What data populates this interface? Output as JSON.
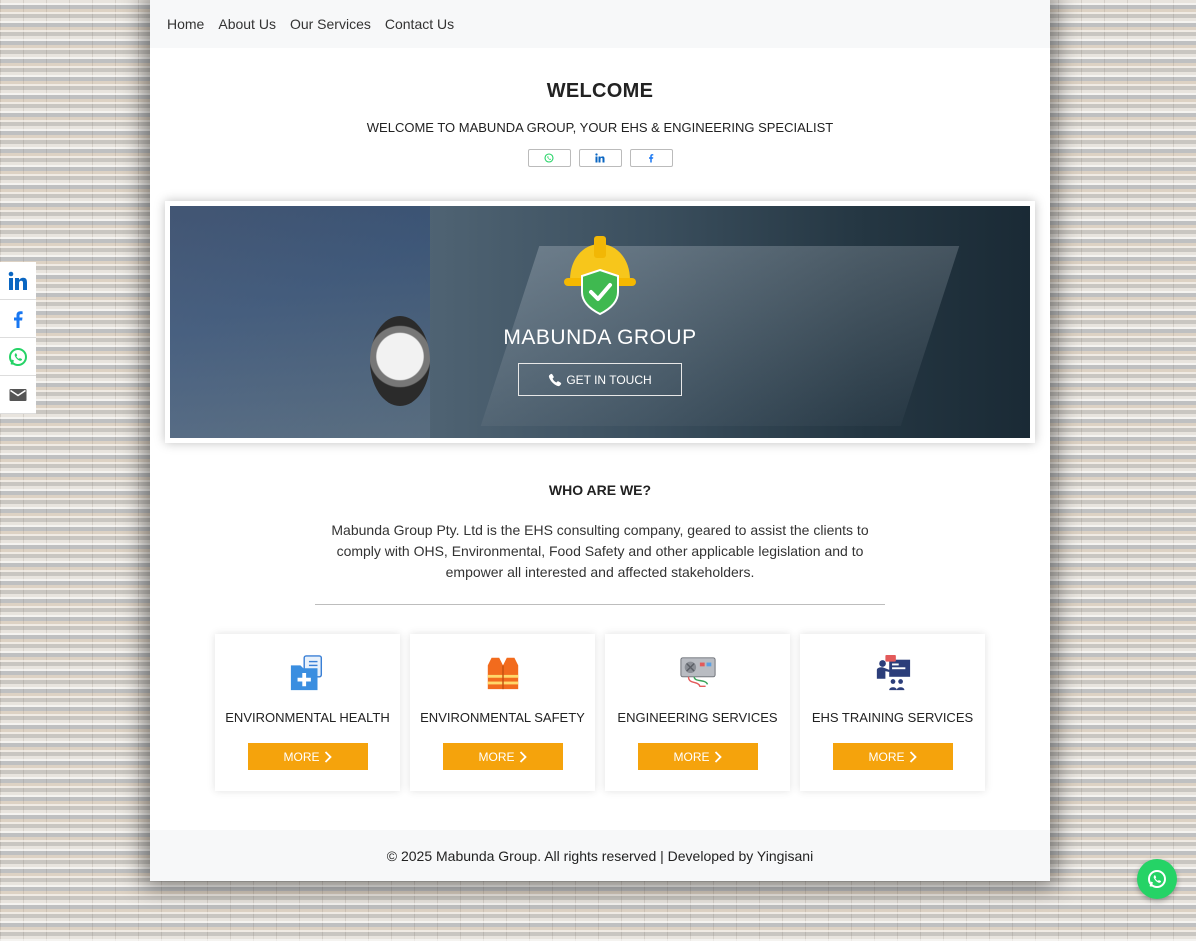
{
  "nav": {
    "items": [
      {
        "label": "Home"
      },
      {
        "label": "About Us"
      },
      {
        "label": "Our Services"
      },
      {
        "label": "Contact Us"
      }
    ]
  },
  "welcome": {
    "title": "WELCOME",
    "subtitle": "WELCOME TO MABUNDA GROUP, YOUR EHS & ENGINEERING SPECIALIST",
    "share_icons": [
      "whatsapp-icon",
      "linkedin-icon",
      "facebook-icon"
    ]
  },
  "hero": {
    "title": "MABUNDA GROUP",
    "cta_label": "GET IN TOUCH",
    "cta_icon": "phone-icon",
    "logo_icon": "helmet-shield-icon"
  },
  "about": {
    "title": "WHO ARE WE?",
    "text": "Mabunda Group Pty. Ltd is the EHS consulting company, geared to assist the clients to comply with OHS, Environmental, Food Safety and other applicable legislation and to empower all interested and affected stakeholders."
  },
  "services": [
    {
      "title": "ENVIRONMENTAL HEALTH",
      "button": "MORE",
      "icon": "medical-folder-icon"
    },
    {
      "title": "ENVIRONMENTAL SAFETY",
      "button": "MORE",
      "icon": "safety-vest-icon"
    },
    {
      "title": "ENGINEERING SERVICES",
      "button": "MORE",
      "icon": "power-supply-icon"
    },
    {
      "title": "EHS TRAINING SERVICES",
      "button": "MORE",
      "icon": "training-presentation-icon"
    }
  ],
  "footer": {
    "text": "© 2025 Mabunda Group. All rights reserved | Developed by Yingisani"
  },
  "side_share": [
    "linkedin-icon",
    "facebook-icon",
    "whatsapp-icon",
    "email-icon"
  ],
  "colors": {
    "accent": "#f5a30c",
    "whatsapp": "#25d366",
    "linkedin": "#0a66c2",
    "facebook": "#1877f2"
  }
}
